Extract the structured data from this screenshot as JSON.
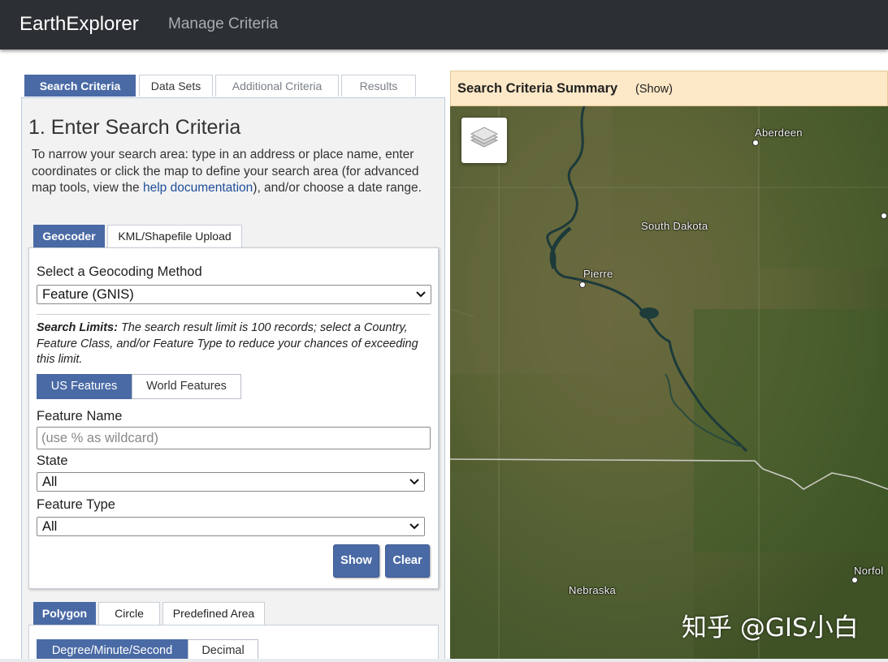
{
  "navbar": {
    "brand": "EarthExplorer",
    "manage_criteria": "Manage Criteria"
  },
  "main_tabs": [
    {
      "label": "Search Criteria",
      "active": true
    },
    {
      "label": "Data Sets",
      "active": false
    },
    {
      "label": "Additional Criteria",
      "active": false
    },
    {
      "label": "Results",
      "active": false
    }
  ],
  "step": {
    "title": "1. Enter Search Criteria",
    "intro_before_link": "To narrow your search area: type in an address or place name, enter coordinates or click the map to define your search area (for advanced map tools, view the ",
    "intro_link": "help documentation",
    "intro_after_link": "), and/or choose a date range."
  },
  "geocoder_tabs": [
    {
      "label": "Geocoder",
      "active": true
    },
    {
      "label": "KML/Shapefile Upload",
      "active": false
    }
  ],
  "geocoder": {
    "method_label": "Select a Geocoding Method",
    "method_value": "Feature (GNIS)",
    "limits_heading": "Search Limits:",
    "limits_text": " The search result limit is 100 records; select a Country, Feature Class, and/or Feature Type to reduce your chances of exceeding this limit.",
    "feature_scope": [
      {
        "label": "US Features",
        "active": true
      },
      {
        "label": "World Features",
        "active": false
      }
    ],
    "feature_name_label": "Feature Name",
    "feature_name_placeholder": "(use % as wildcard)",
    "state_label": "State",
    "state_value": "All",
    "feature_type_label": "Feature Type",
    "feature_type_value": "All",
    "show_button": "Show",
    "clear_button": "Clear"
  },
  "area_tabs": [
    {
      "label": "Polygon",
      "active": true
    },
    {
      "label": "Circle",
      "active": false
    },
    {
      "label": "Predefined Area",
      "active": false
    }
  ],
  "coord_format": [
    {
      "label": "Degree/Minute/Second",
      "active": true
    },
    {
      "label": "Decimal",
      "active": false
    }
  ],
  "summary": {
    "title": "Search Criteria Summary",
    "toggle": "(Show)"
  },
  "map": {
    "layers_icon": "layers-icon",
    "labels": {
      "aberdeen": "Aberdeen",
      "south_dakota": "South Dakota",
      "pierre": "Pierre",
      "nebraska": "Nebraska",
      "norfolk": "Norfol"
    },
    "watermark": "知乎 @GIS小白"
  },
  "colors": {
    "accent": "#4a6aa5",
    "navbar": "#2c2f33",
    "summary_bg": "#fde8c7"
  }
}
